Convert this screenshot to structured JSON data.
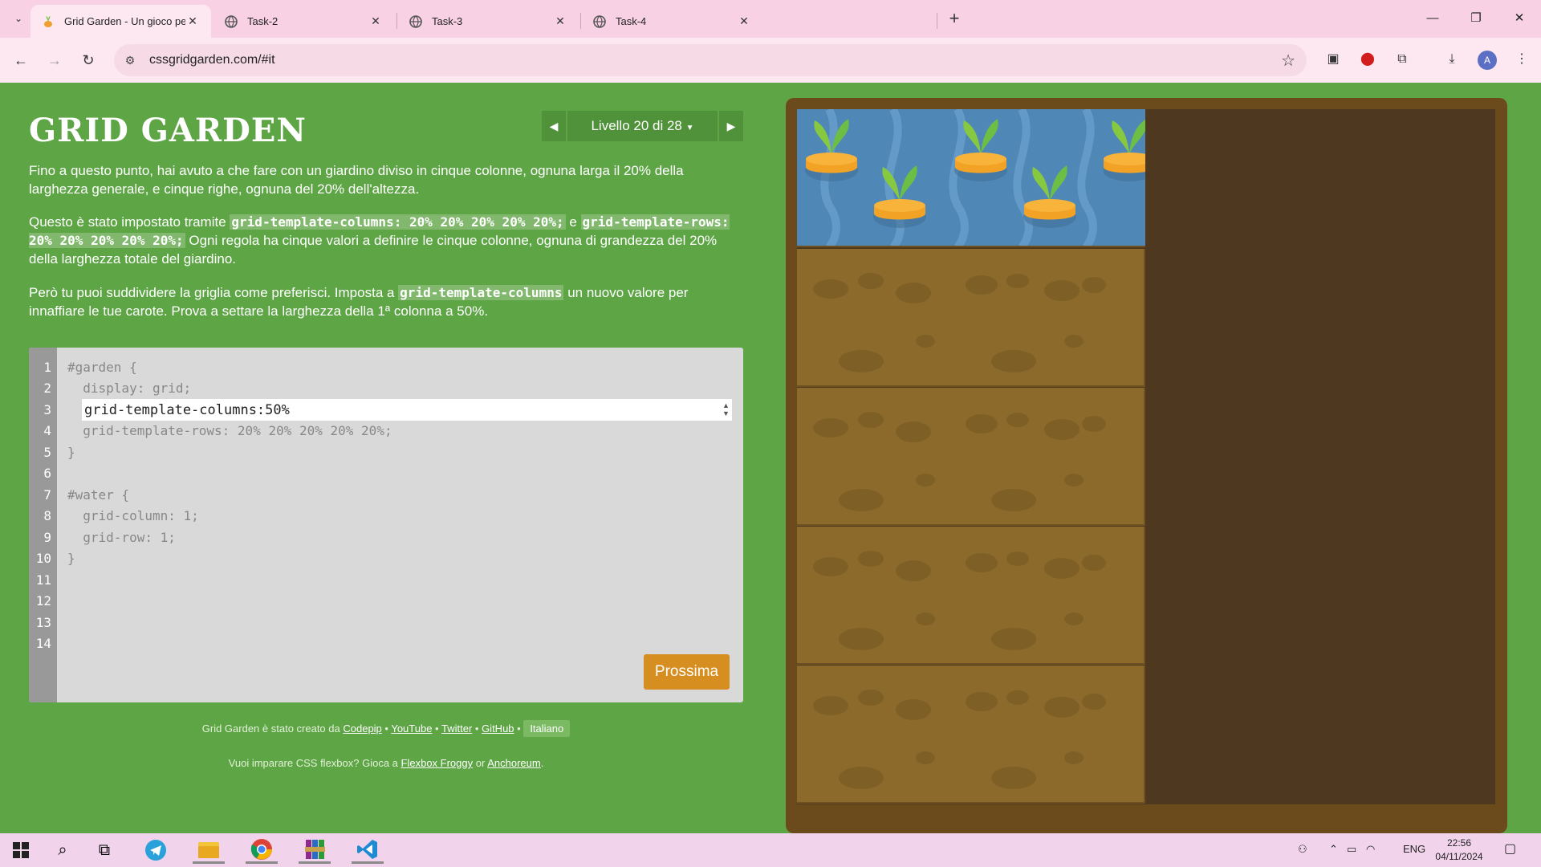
{
  "browser": {
    "tabs": [
      {
        "title": "Grid Garden - Un gioco per impara",
        "active": true
      },
      {
        "title": "Task-2",
        "active": false
      },
      {
        "title": "Task-3",
        "active": false
      },
      {
        "title": "Task-4",
        "active": false
      }
    ],
    "url": "cssgridgarden.com/#it",
    "profile_initial": "A"
  },
  "game": {
    "title": "GRID GARDEN",
    "level_label": "Livello 20 di 28",
    "paragraph1": "Fino a questo punto, hai avuto a che fare con un giardino diviso in cinque colonne, ognuna larga il 20% della larghezza generale, e cinque righe, ognuna del 20% dell'altezza.",
    "paragraph2": {
      "t1": "Questo è stato impostato tramite ",
      "code1": "grid-template-columns: 20% 20% 20% 20% 20%;",
      "t2": " e ",
      "code2": "grid-template-rows: 20% 20% 20% 20% 20%;",
      "t3": " Ogni regola ha cinque valori a definire le cinque colonne, ognuna di grandezza del 20% della larghezza totale del giardino."
    },
    "paragraph3": {
      "t1": "Però tu puoi suddividere la griglia come preferisci. Imposta a ",
      "code1": "grid-template-columns",
      "t2": " un nuovo valore per innaffiare le tue carote. Prova a settare la larghezza della 1ª colonna a 50%."
    },
    "editor": {
      "line_numbers": [
        "1",
        "2",
        "3",
        "4",
        "5",
        "6",
        "7",
        "8",
        "9",
        "10",
        "11",
        "12",
        "13",
        "14"
      ],
      "lines": {
        "l1": "#garden {",
        "l2": "  display: grid;",
        "l4": "  grid-template-rows: 20% 20% 20% 20% 20%;",
        "l5": "}",
        "l7": "#water {",
        "l8": "  grid-column: 1;",
        "l9": "  grid-row: 1;",
        "l10": "}"
      },
      "input_value": "grid-template-columns:50%",
      "next_button": "Prossima"
    },
    "footer": {
      "created_by": "Grid Garden è stato creato da",
      "links": [
        "Codepip",
        "YouTube",
        "Twitter",
        "GitHub"
      ],
      "language": "Italiano",
      "flexbox_text": "Vuoi imparare CSS flexbox? Gioca a",
      "flexbox_link": "Flexbox Froggy",
      "or": "or",
      "anchoreum_link": "Anchoreum"
    }
  },
  "taskbar": {
    "language": "ENG",
    "time": "22:56",
    "date": "04/11/2024"
  },
  "colors": {
    "page_bg": "#5ea546",
    "water": "#4f88b7",
    "dirt": "#8b6a2b",
    "button": "#d58e1f"
  }
}
